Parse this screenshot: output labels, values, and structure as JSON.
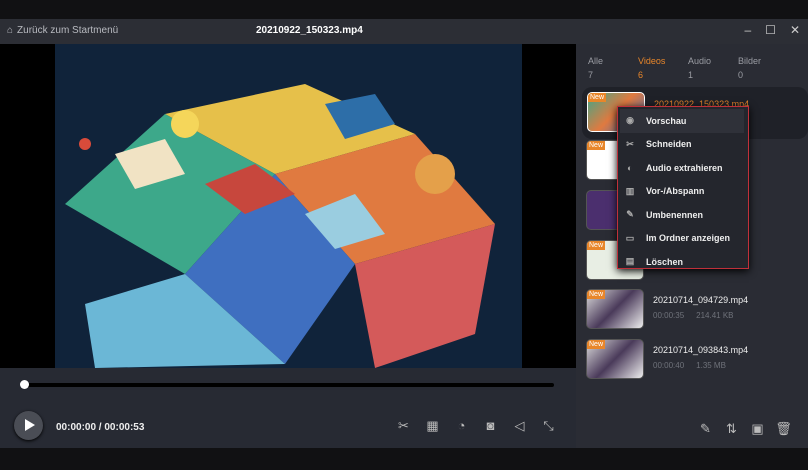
{
  "titlebar": {
    "back_label": "Zurück zum Startmenü",
    "file_title": "20210922_150323.mp4"
  },
  "player": {
    "time": "00:00:00 / 00:00:53",
    "progress": 0
  },
  "tabs": [
    {
      "label": "Alle",
      "count": "7"
    },
    {
      "label": "Videos",
      "count": "6"
    },
    {
      "label": "Audio",
      "count": "1"
    },
    {
      "label": "Bilder",
      "count": "0"
    }
  ],
  "badge": "New",
  "files": [
    {
      "name": "20210922_150323.mp4"
    },
    {
      "name": "20210714_094729.mp4",
      "duration": "00:00:35",
      "size": "214.41 KB"
    },
    {
      "name": "20210714_093843.mp4",
      "duration": "00:00:40",
      "size": "1.35 MB"
    }
  ],
  "context_menu": [
    "Vorschau",
    "Schneiden",
    "Audio extrahieren",
    "Vor-/Abspann",
    "Umbenennen",
    "Im Ordner anzeigen",
    "Löschen"
  ],
  "colors": {
    "accent": "#e8862a",
    "menu_border": "#c0303a"
  }
}
